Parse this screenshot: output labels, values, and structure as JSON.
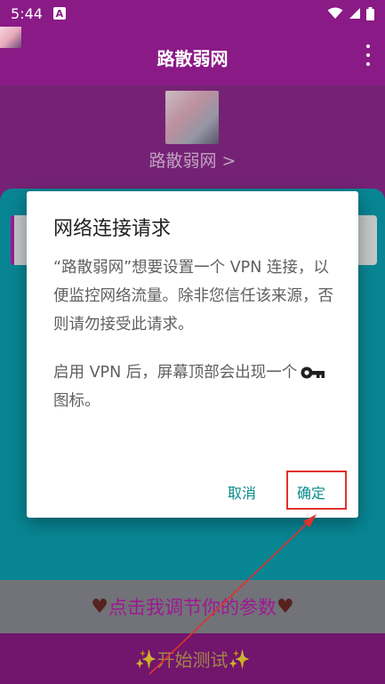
{
  "status_bar": {
    "time": "5:44",
    "app_glyph": "A"
  },
  "app_bar": {
    "title": "路散弱网"
  },
  "profile": {
    "name": "路散弱网 >"
  },
  "dialog": {
    "title": "网络连接请求",
    "paragraph1": "“路散弱网”想要设置一个 VPN 连接，以便监控网络流量。除非您信任该来源，否则请勿接受此请求。",
    "paragraph2_before": "启用 VPN 后，屏幕顶部会出现一个",
    "paragraph2_after": "图标。",
    "cancel_label": "取消",
    "ok_label": "确定"
  },
  "params_button": {
    "heart_left": "♥",
    "label": "点击我调节你的参数",
    "heart_right": "♥"
  },
  "start_button": {
    "sparkle_left": "✨",
    "label": "开始测试",
    "sparkle_right": "✨"
  },
  "colors": {
    "accent": "#8a1a86",
    "teal": "#0aa3b4",
    "dialog_button": "#0a8a8a",
    "highlight": "#e0322c"
  },
  "icons": [
    "wifi-icon",
    "signal-icon",
    "battery-icon",
    "overflow-menu-icon",
    "vpn-key-icon"
  ]
}
